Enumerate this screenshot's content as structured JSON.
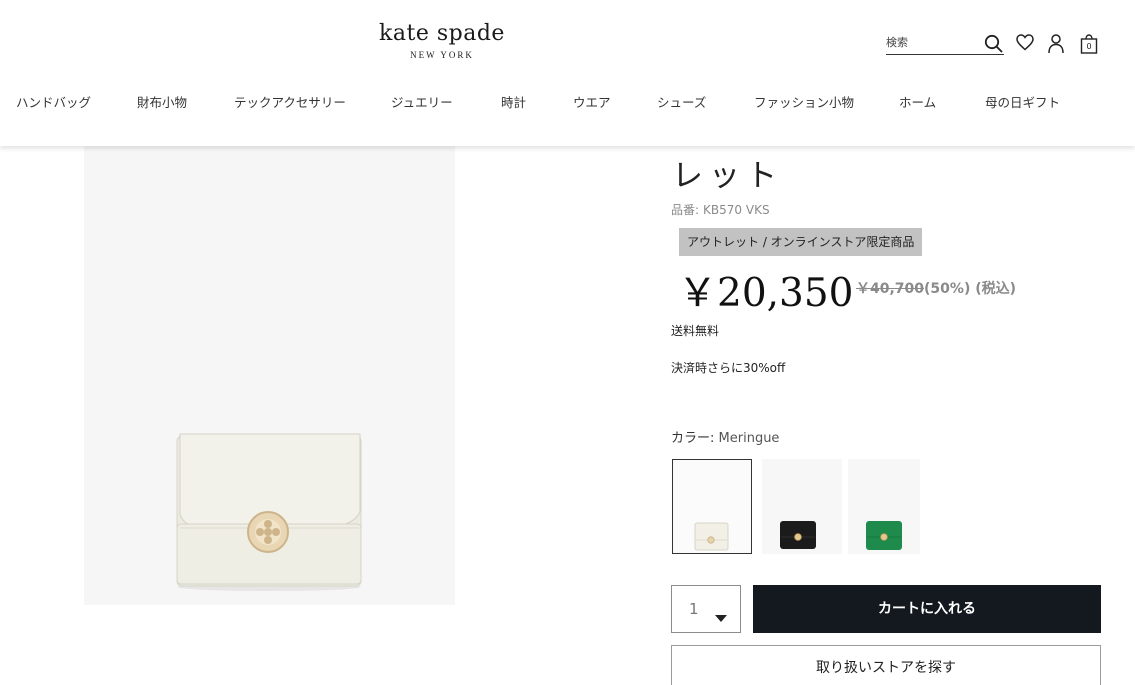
{
  "header": {
    "logo": {
      "name": "kate spade",
      "sub": "NEW YORK"
    },
    "search": {
      "placeholder": "検索",
      "value": ""
    },
    "cart": {
      "count": "0"
    },
    "icons": [
      "search-icon",
      "heart-icon",
      "user-icon",
      "bag-icon"
    ]
  },
  "nav": {
    "items": [
      {
        "label": "ハンドバッグ"
      },
      {
        "label": "財布小物"
      },
      {
        "label": "テックアクセサリー"
      },
      {
        "label": "ジュエリー"
      },
      {
        "label": "時計"
      },
      {
        "label": "ウエア"
      },
      {
        "label": "シューズ"
      },
      {
        "label": "ファッション小物"
      },
      {
        "label": "ホーム"
      },
      {
        "label": "母の日ギフト"
      }
    ]
  },
  "product": {
    "title_fragment": "レット",
    "sku_label": "品番:",
    "sku": "KB570 VKS",
    "badge": "アウトレット / オンラインストア限定商品",
    "price": "￥20,350",
    "original_price": "￥40,700",
    "discount": "(50%)",
    "tax_note": "(税込)",
    "shipping": "送料無料",
    "checkout_note": "決済時さらに30%off",
    "color_label": "カラー:",
    "color_value": "Meringue",
    "swatches": [
      {
        "color": "Meringue",
        "hex": "#f1efe6",
        "selected": true
      },
      {
        "color": "Black",
        "hex": "#1b1b1b",
        "selected": false
      },
      {
        "color": "Green",
        "hex": "#1e8a4c",
        "selected": false
      }
    ],
    "quantity": "1",
    "add_to_cart": "カートに入れる",
    "find_store": "取り扱いストアを探す"
  },
  "colors": {
    "cart_button": "#13191e",
    "badge_bg": "#c2c2c2",
    "image_bg": "#f6f6f6"
  }
}
